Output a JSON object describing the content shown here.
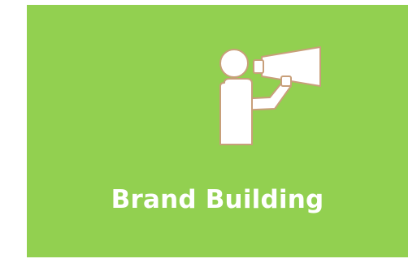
{
  "card": {
    "icon": "megaphone-person-icon",
    "title": "Brand Building",
    "background_color": "#92d050",
    "icon_fill": "#ffffff",
    "icon_stroke": "#c89f7a"
  }
}
